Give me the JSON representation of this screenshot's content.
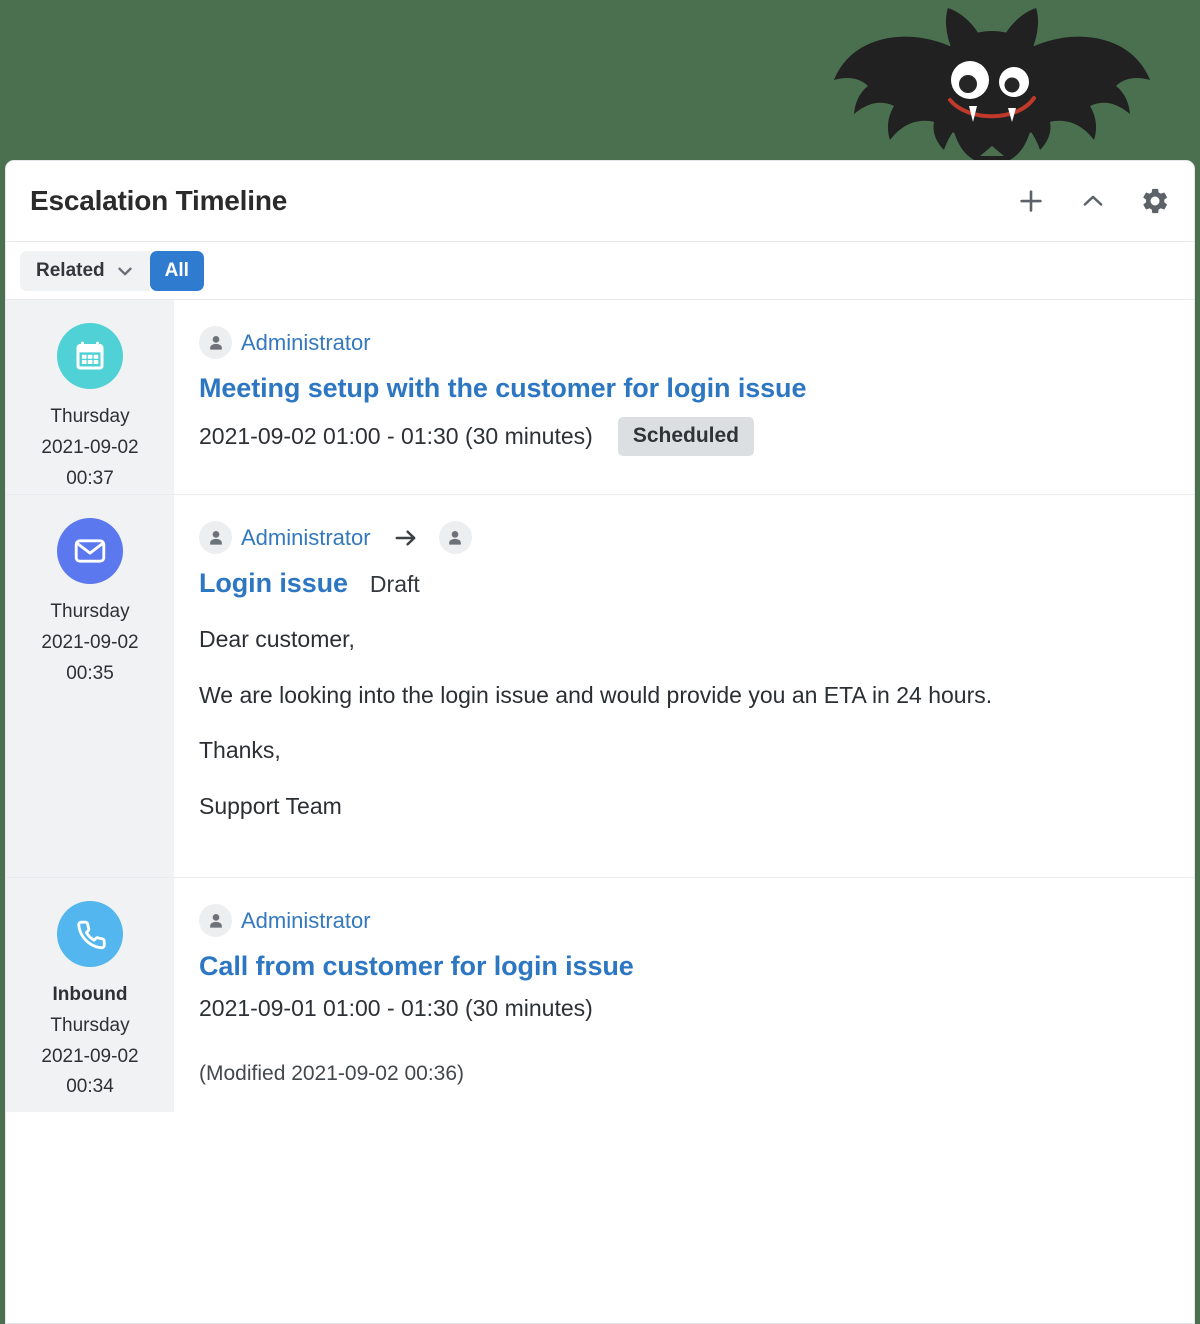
{
  "theme": {
    "background": "#4a7050",
    "card_background": "#ffffff",
    "link_blue": "#3478bd",
    "accent_blue": "#2e7bcf",
    "badge_gray": "#dcdfe2",
    "sidebar_gray": "#f1f2f3",
    "meeting_icon_color": "#4fd1d5",
    "email_icon_color": "#5b78ef",
    "call_icon_color": "#53b6ee"
  },
  "banner": {
    "illustration": "bat-illustration"
  },
  "header": {
    "title": "Escalation Timeline",
    "actions": [
      {
        "name": "add-button",
        "icon": "plus-icon"
      },
      {
        "name": "collapse-button",
        "icon": "chevron-up-icon"
      },
      {
        "name": "settings-button",
        "icon": "gear-icon"
      }
    ]
  },
  "filter_bar": {
    "related_label": "Related",
    "related_icon": "chevron-down-icon",
    "all_label": "All"
  },
  "timeline": {
    "entries": [
      {
        "icon": "calendar-icon",
        "icon_color": "#4fd1d5",
        "direction_label": "",
        "day": "Thursday",
        "date": "2021-09-02",
        "time": "00:37",
        "actor": "Administrator",
        "has_recipient": false,
        "title": "Meeting setup with the customer for login issue",
        "state_label": "",
        "meta": "2021-09-02 01:00 - 01:30 (30 minutes)",
        "badge": "Scheduled",
        "body": [],
        "modified": ""
      },
      {
        "icon": "envelope-icon",
        "icon_color": "#5b78ef",
        "direction_label": "",
        "day": "Thursday",
        "date": "2021-09-02",
        "time": "00:35",
        "actor": "Administrator",
        "has_recipient": true,
        "title": "Login issue",
        "state_label": "Draft",
        "meta": "",
        "badge": "",
        "body": [
          "Dear customer,",
          "We are looking into the login issue and would provide you an ETA in 24 hours.",
          "Thanks,",
          "Support Team"
        ],
        "modified": ""
      },
      {
        "icon": "phone-icon",
        "icon_color": "#53b6ee",
        "direction_label": "Inbound",
        "day": "Thursday",
        "date": "2021-09-02",
        "time": "00:34",
        "actor": "Administrator",
        "has_recipient": false,
        "title": "Call from customer for login issue",
        "state_label": "",
        "meta": "2021-09-01 01:00 - 01:30 (30 minutes)",
        "badge": "",
        "body": [],
        "modified": "(Modified 2021-09-02 00:36)"
      }
    ]
  }
}
